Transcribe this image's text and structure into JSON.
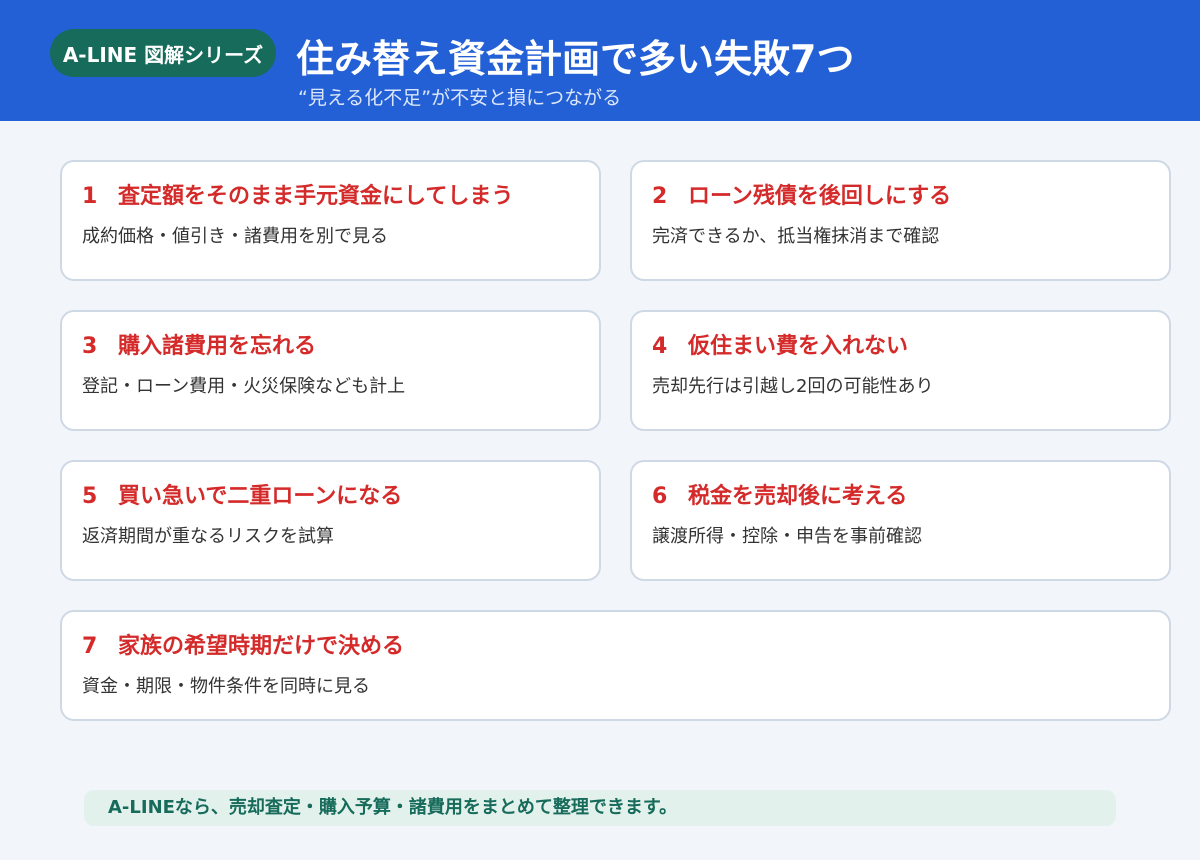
{
  "header": {
    "badge": "A-LINE 図解シリーズ",
    "title": "住み替え資金計画で多い失敗7つ",
    "subtitle": "“見える化不足”が不安と損につながる"
  },
  "cards": [
    {
      "num": "1",
      "title": "査定額をそのまま手元資金にしてしまう",
      "desc": "成約価格・値引き・諸費用を別で見る"
    },
    {
      "num": "2",
      "title": "ローン残債を後回しにする",
      "desc": "完済できるか、抵当権抹消まで確認"
    },
    {
      "num": "3",
      "title": "購入諸費用を忘れる",
      "desc": "登記・ローン費用・火災保険なども計上"
    },
    {
      "num": "4",
      "title": "仮住まい費を入れない",
      "desc": "売却先行は引越し2回の可能性あり"
    },
    {
      "num": "5",
      "title": "買い急いで二重ローンになる",
      "desc": "返済期間が重なるリスクを試算"
    },
    {
      "num": "6",
      "title": "税金を売却後に考える",
      "desc": "譲渡所得・控除・申告を事前確認"
    },
    {
      "num": "7",
      "title": "家族の希望時期だけで決める",
      "desc": "資金・期限・物件条件を同時に見る"
    }
  ],
  "footer": {
    "text": "A-LINEなら、売却査定・購入予算・諸費用をまとめて整理できます。"
  },
  "colors": {
    "header_bg": "#2360d6",
    "badge_bg": "#166b5b",
    "card_title": "#d42a2a",
    "footer_bg": "#e3f1ec",
    "footer_text": "#166b5b",
    "page_bg": "#f2f6fb"
  }
}
